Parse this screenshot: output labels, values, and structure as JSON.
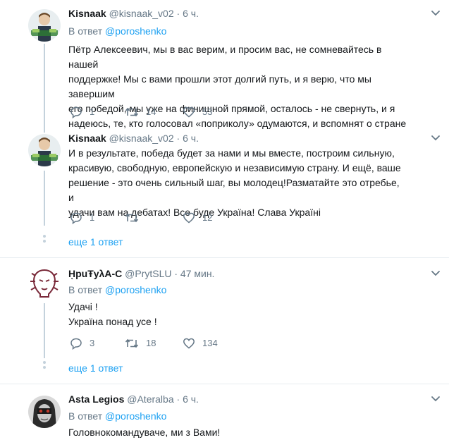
{
  "tweets": [
    {
      "name": "Kisnaak",
      "handle": "@kisnaak_v02",
      "dot": "·",
      "time": "6 ч.",
      "reply_prefix": "В ответ",
      "reply_to": "@poroshenko",
      "text": "Пётр Алексеевич, мы в вас верим, и просим вас, не сомневайтесь в нашей\nподдержке! Мы с вами прошли этот долгий путь, и я верю, что мы завершим\nего победой, мы уже на финишной прямой, осталось - не свернуть, и я\nнадеюсь, те, кто голосовал «поприколу» одумаются, и вспомнят о стране",
      "replies": "1",
      "retweets": "14",
      "likes": "53"
    },
    {
      "name": "Kisnaak",
      "handle": "@kisnaak_v02",
      "dot": "·",
      "time": "6 ч.",
      "text": "И в результате, победа будет за нами и мы вместе, построим сильную,\nкрасивую, свободную, европейскую и независимую страну. И ещё, ваше\nрешение - это очень сильный шаг, вы молодец!Разматайте это отребье, и\nудачи вам на дебатах! Все буде Україна! Слава Україні",
      "replies": "1",
      "retweets": "",
      "likes": "12",
      "more": "еще 1 ответ"
    },
    {
      "name": "ῌpuŦyλA-C",
      "handle": "@PrytSLU",
      "dot": "·",
      "time": "47 мин.",
      "reply_prefix": "В ответ",
      "reply_to": "@poroshenko",
      "text": "Удачі !\nУкраїна понад усе !",
      "replies": "3",
      "retweets": "18",
      "likes": "134",
      "more": "еще 1 ответ"
    },
    {
      "name": "Asta Legios",
      "handle": "@Ateralba",
      "dot": "·",
      "time": "6 ч.",
      "reply_prefix": "В ответ",
      "reply_to": "@poroshenko",
      "text": "Головнокомандуваче, ми з Вами!"
    }
  ],
  "colors": {
    "accent": "#1da1f2",
    "muted": "#657786",
    "thread_line": "#c4d2dc",
    "separator": "#e6ecf0"
  }
}
